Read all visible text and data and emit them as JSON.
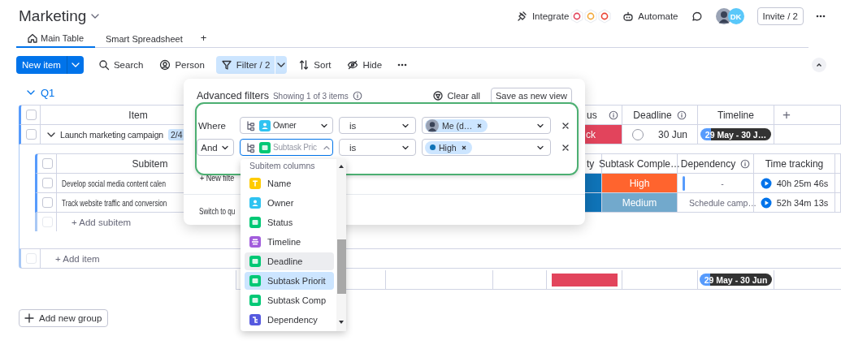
{
  "board": {
    "title": "Marketing"
  },
  "header": {
    "integrate": "Integrate",
    "automate": "Automate",
    "member_initials": "DK",
    "invite": "Invite / 2"
  },
  "views": [
    {
      "label": "Main Table",
      "selected": true
    },
    {
      "label": "Smart Spreadsheet",
      "selected": false
    }
  ],
  "add_view": "+",
  "toolbar": {
    "new_item": "New item",
    "actions": [
      {
        "label": "Search",
        "active": false
      },
      {
        "label": "Person",
        "active": false
      },
      {
        "label": "Filter / 2",
        "active": true
      },
      {
        "label": "Sort",
        "active": false
      },
      {
        "label": "Hide",
        "active": false
      }
    ]
  },
  "group": {
    "title": "Q1",
    "expanded": true,
    "all_checked": false,
    "item_header": "Item",
    "status_header": "us",
    "deadline_header": "Deadline",
    "timeline_header": "Timeline",
    "add_column": "+",
    "items": [
      {
        "name": "Launch marketing campaign",
        "checked": false,
        "expanded": true,
        "subitem_count": "2/4",
        "status": {
          "label": "ck",
          "color": "#e2445c"
        },
        "deadline": "30 Jun",
        "deadline_done": false,
        "timeline": "29 May - 30 J…"
      }
    ],
    "subitems": {
      "all_checked": false,
      "subitem_header": "Subitem",
      "priority_header": "ty",
      "completion_header": "Subtask Comple…",
      "dependency_header": "Dependency",
      "time_header": "Time tracking",
      "rows": [
        {
          "name": "Develop social media content calen",
          "checked": false,
          "priority": {
            "color": "#0f73b7"
          },
          "completion": {
            "label": "High",
            "color": "#ff642e"
          },
          "dependency": "-",
          "time": "40h 25m 46s"
        },
        {
          "name": "Track website traffic and conversion",
          "checked": false,
          "priority": {
            "color": "#0f73b7"
          },
          "completion": {
            "label": "Medium",
            "color": "#72a9cc"
          },
          "dependency": "Schedule camp…",
          "time": "52h 34m 13s"
        }
      ],
      "add_row_checked": false,
      "add_subitem": "+ Add subitem"
    },
    "add_row_checked": false,
    "add_item": "+ Add item",
    "summary": {
      "status": {
        "color": "#e2445c"
      },
      "timeline": "29 May - 30 Jun"
    }
  },
  "add_group": "Add new group",
  "filter_panel": {
    "title": "Advanced filters",
    "summary": "Showing 1 of 3 items",
    "clear_all": "Clear all",
    "save_view": "Save as new view",
    "rules": [
      {
        "conjunction": {
          "label": "Where",
          "kind": "label"
        },
        "column": {
          "label": "Owner",
          "kind": "people"
        },
        "open": false,
        "operator": "is",
        "value": {
          "label": "Me (d…",
          "kind": "person"
        }
      },
      {
        "conjunction": {
          "label": "And",
          "kind": "dropdown"
        },
        "column": {
          "label": "Subtask Pric",
          "kind": "status"
        },
        "open": true,
        "operator": "is",
        "value": {
          "label": "High",
          "kind": "status",
          "color": "#0f73b7"
        }
      }
    ],
    "new_filter": "+ New filte",
    "switch_text": "Switch to qu"
  },
  "column_menu": {
    "heading": "Subitem columns",
    "items": [
      {
        "label": "Name",
        "kind": "text",
        "hovered": false,
        "selected": false
      },
      {
        "label": "Owner",
        "kind": "people",
        "hovered": false,
        "selected": false
      },
      {
        "label": "Status",
        "kind": "status",
        "hovered": false,
        "selected": false
      },
      {
        "label": "Timeline",
        "kind": "timeline",
        "hovered": false,
        "selected": false
      },
      {
        "label": "Deadline",
        "kind": "date",
        "hovered": true,
        "selected": false
      },
      {
        "label": "Subtask Priorit",
        "kind": "status",
        "hovered": false,
        "selected": true
      },
      {
        "label": "Subtask Comp",
        "kind": "status",
        "hovered": false,
        "selected": false
      },
      {
        "label": "Dependency",
        "kind": "dependency",
        "hovered": false,
        "selected": false
      }
    ]
  }
}
